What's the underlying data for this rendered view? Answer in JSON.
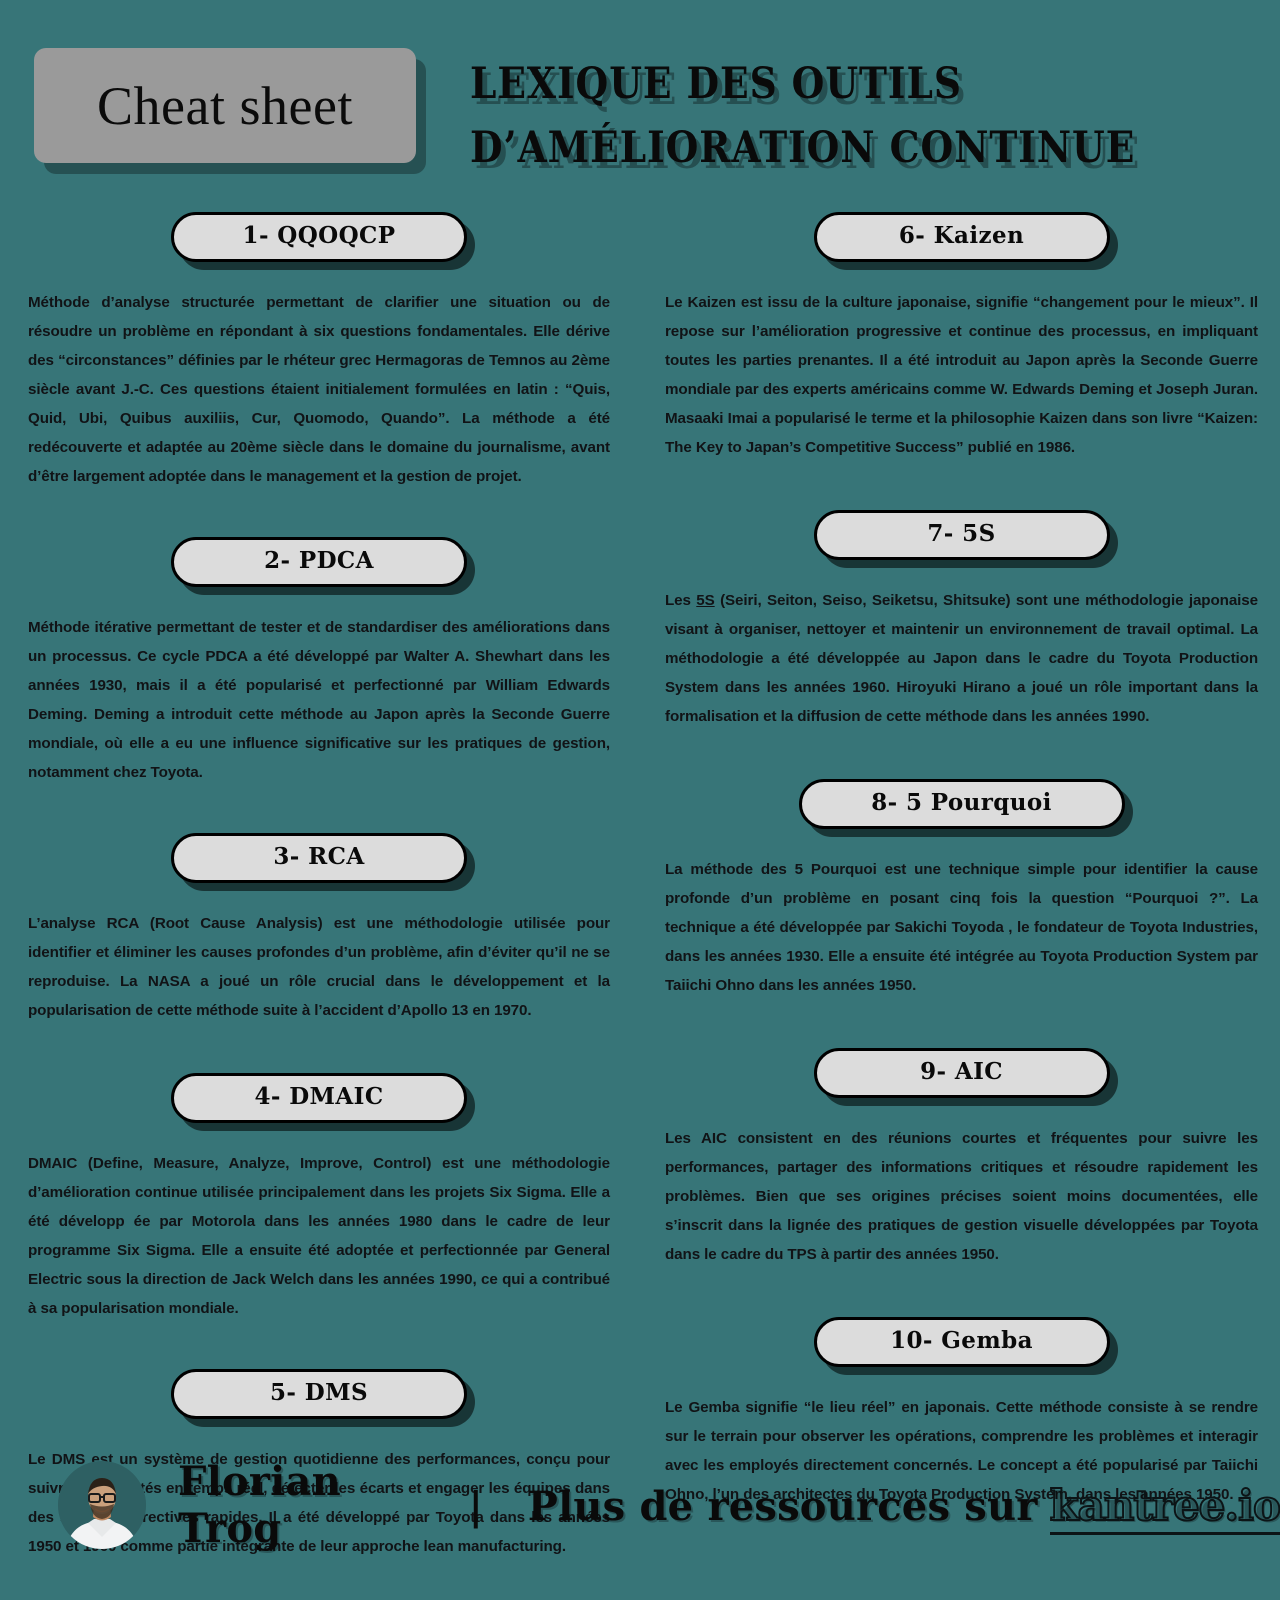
{
  "header": {
    "badge_label": "Cheat sheet",
    "title_line1": "Lexique des outils",
    "title_line2": "d’amélioration continue"
  },
  "theme": {
    "background": "#377578",
    "badge_bg": "#9a9a9a",
    "pill_bg": "#dcdcdc",
    "text": "#111316",
    "outline": "#000000"
  },
  "left_column": [
    {
      "pill": "1- QQOQCP",
      "text": "Méthode d’analyse structurée permettant de clarifier une situation ou de résoudre un problème en répondant à six questions fondamentales. Elle dérive des “circonstances” définies par le rhéteur grec Hermagoras de Temnos au 2ème siècle avant J.-C. Ces questions étaient initialement formulées en latin : “Quis, Quid, Ubi, Quibus auxiliis, Cur, Quomodo, Quando”. La méthode a été redécouverte et adaptée au 20ème siècle dans le domaine du journalisme, avant d’être largement adoptée dans le management et la gestion de projet."
    },
    {
      "pill": "2- PDCA",
      "text": "Méthode itérative permettant de tester et de standardiser des améliorations dans un processus. Ce cycle PDCA a été développé par Walter A. Shewhart dans les années 1930, mais il a été popularisé et perfectionné par William Edwards Deming. Deming a introduit cette méthode au Japon après la Seconde Guerre mondiale, où elle a eu une influence significative sur les pratiques de gestion, notamment chez Toyota."
    },
    {
      "pill": "3- RCA",
      "text": "L’analyse RCA (Root Cause Analysis) est une méthodologie utilisée pour identifier et éliminer les causes profondes d’un problème, afin d’éviter qu’il ne se reproduise. La NASA a joué un rôle crucial dans le développement et la popularisation de cette méthode suite à l’accident d’Apollo 13 en 1970."
    },
    {
      "pill": "4- DMAIC",
      "text": "DMAIC (Define, Measure, Analyze, Improve, Control) est une méthodologie d’amélioration continue utilisée principalement dans les projets Six Sigma. Elle a été développ ée par Motorola dans les années 1980 dans le cadre de leur programme Six Sigma. Elle a ensuite été adoptée et perfectionnée par General Electric sous la direction de Jack Welch dans les années 1990, ce qui a contribué à sa popularisation mondiale."
    },
    {
      "pill": "5- DMS",
      "text": "Le DMS est un système de gestion quotidienne des performances, conçu pour suivre les activités en temps réel, détecter les écarts et engager les équipes dans des actions correctives rapides. Il a été développé par Toyota dans les années 1950 et 1960 comme partie intégrante de leur approche lean manufacturing."
    }
  ],
  "right_column": [
    {
      "pill": "6- Kaizen",
      "text": "Le Kaizen est issu de la culture japonaise, signifie “changement pour le mieux”. Il repose sur l’amélioration progressive et continue des processus, en impliquant toutes les parties prenantes. Il a été introduit au Japon après la Seconde Guerre mondiale par des experts américains comme W. Edwards Deming et Joseph Juran. Masaaki Imai a popularisé le terme et la philosophie Kaizen dans son livre “Kaizen: The Key to Japan’s Competitive Success” publié en 1986."
    },
    {
      "pill": "7- 5S",
      "text_pre": "Les ",
      "text_underline": "5S",
      "text": " (Seiri, Seiton, Seiso, Seiketsu, Shitsuke) sont une méthodologie japonaise visant à organiser, nettoyer et maintenir un environnement de travail optimal. La méthodologie a été développée au Japon dans le cadre du Toyota Production System dans les années 1960. Hiroyuki Hirano a joué un rôle important dans la formalisation et la diffusion de cette méthode dans les années 1990."
    },
    {
      "pill": "8- 5 Pourquoi",
      "text": "La méthode des 5 Pourquoi est une technique simple pour identifier la cause profonde d’un problème en posant cinq fois la question “Pourquoi ?”. La technique a été développée par Sakichi Toyoda , le fondateur de Toyota Industries, dans les années 1930. Elle a ensuite été intégrée au Toyota Production System par Taiichi Ohno dans les années 1950."
    },
    {
      "pill": "9- AIC",
      "text": "Les AIC consistent en des réunions courtes et fréquentes pour suivre les performances, partager des informations critiques et résoudre rapidement les problèmes. Bien que ses origines précises soient moins documentées, elle s’inscrit dans la lignée des pratiques de gestion visuelle développées par Toyota dans le cadre du TPS à partir des années 1950."
    },
    {
      "pill": "10- Gemba",
      "text": "Le Gemba signifie “le lieu réel” en japonais. Cette méthode consiste à se rendre sur le terrain pour observer les opérations, comprendre les problèmes et interagir avec les employés directement concernés. Le concept a été popularisé par Taiichi Ohno, l’un des architectes du Toyota Production System, dans les années 1950."
    }
  ],
  "footer": {
    "author": "Florian Trog",
    "separator": "|",
    "promo_text": "Plus de ressources sur",
    "brand": "kantree.io"
  }
}
